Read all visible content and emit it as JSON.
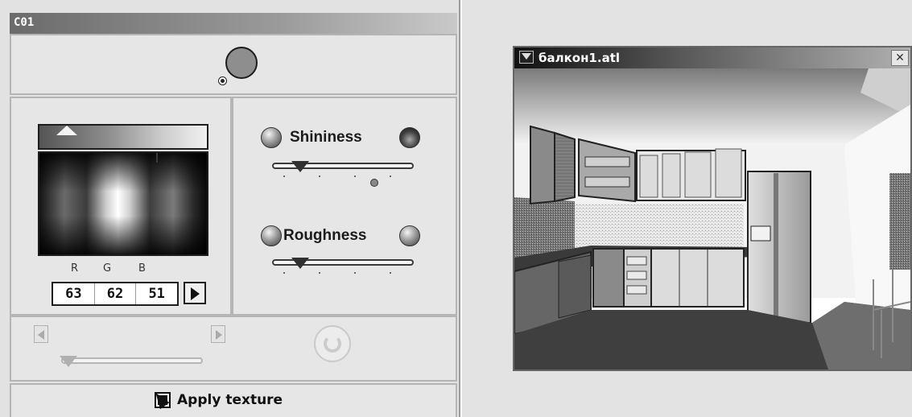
{
  "panel": {
    "title": "C01",
    "color": {
      "rgb_labels": [
        "R",
        "G",
        "B"
      ],
      "rgb_values": [
        "63",
        "62",
        "51"
      ]
    },
    "surface": {
      "shininess_label": "Shininess",
      "roughness_label": "Roughness",
      "shininess_level": 0.2,
      "roughness_level": 0.2
    },
    "texture": {
      "apply_label": "Apply texture",
      "checked": true,
      "level": 0.05
    }
  },
  "viewer": {
    "title": "балкон1.atl",
    "close_glyph": "✕"
  }
}
